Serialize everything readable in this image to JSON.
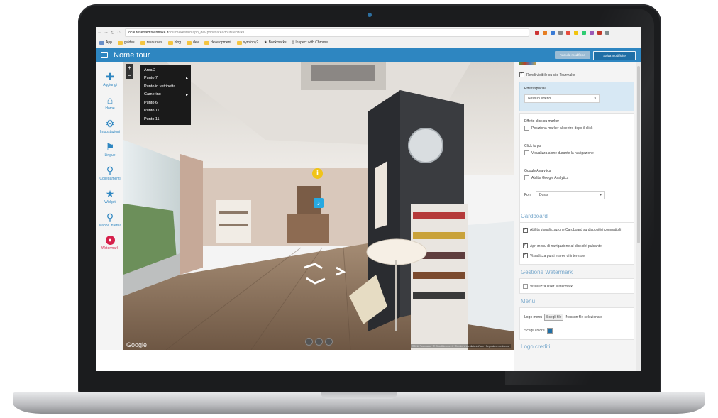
{
  "browser": {
    "url_host": "local.reserved.tourmake.it",
    "url_path": "/tourmake/web/app_dev.php/it/area/tours/edit/49",
    "bookmarks": [
      "App",
      "guides",
      "resources",
      "blog",
      "dev",
      "development",
      "symfony2",
      "Bookmarks",
      "Inspect with Chrome"
    ]
  },
  "header": {
    "title": "Nome tour",
    "cancel_label": "Annulla modifiche",
    "save_label": "Salva modifiche"
  },
  "sidebar": {
    "items": [
      {
        "label": "Aggiungi",
        "icon": "plus-icon"
      },
      {
        "label": "Home",
        "icon": "home-icon"
      },
      {
        "label": "Impostazioni",
        "icon": "settings-icon"
      },
      {
        "label": "Lingue",
        "icon": "flag-icon"
      },
      {
        "label": "Collegamenti",
        "icon": "link-icon"
      },
      {
        "label": "Widget",
        "icon": "star-icon"
      },
      {
        "label": "Mappa interna",
        "icon": "map-pin-icon"
      },
      {
        "label": "Watermark",
        "icon": "heart-icon"
      }
    ]
  },
  "pano": {
    "zoom_in": "+",
    "zoom_out": "−",
    "layer_menu": [
      {
        "label": "Area 2",
        "has_sub": false
      },
      {
        "label": "Punto 7",
        "has_sub": true
      },
      {
        "label": "Punto in vetrinetta",
        "has_sub": false
      },
      {
        "label": "Camerino",
        "has_sub": true
      },
      {
        "label": "Punto 6",
        "has_sub": false
      },
      {
        "label": "Punto 11",
        "has_sub": false
      },
      {
        "label": "Punto 11",
        "has_sub": false
      }
    ],
    "google_label": "Google",
    "credits": "©2016 Tourmake · © GoodMove s.r.l. · Termini e condizioni d'uso · Segnala un problema",
    "info_glyph": "i",
    "audio_glyph": "♪"
  },
  "panel": {
    "visible_site_label": "Rendi visibile su sito Tourmake",
    "special_effects_title": "Effetti speciali",
    "special_effects_value": "Nessun effetto",
    "click_effect_title": "Effetto click su marker",
    "click_effect_option": "Posiziona marker al centro dopo il click",
    "click_to_go_title": "Click to go",
    "click_to_go_option": "Visualizza alone durante la navigazione",
    "analytics_title": "Google Analytics",
    "analytics_option": "Abilita Google Analytics",
    "font_label": "Font",
    "font_value": "Dosis",
    "cardboard_title": "Cardboard",
    "cardboard_opt1": "Abilita visualizzazione Cardboard su dispositivi compatibili",
    "cardboard_opt2": "Apri menu di navigazione al click del pulsante",
    "cardboard_opt3": "Visualizza punti e aree di interesse",
    "watermark_title": "Gestione Watermark",
    "watermark_opt": "Visualizza User Watermark",
    "menu_title": "Menù",
    "logo_label": "Logo menù",
    "file_button": "Scegli file",
    "no_file": "Nessun file selezionato",
    "color_label": "Scegli colore",
    "logo_credits_title": "Logo crediti"
  },
  "colors": {
    "accent": "#2e86c1",
    "watermark": "#d6204b"
  }
}
